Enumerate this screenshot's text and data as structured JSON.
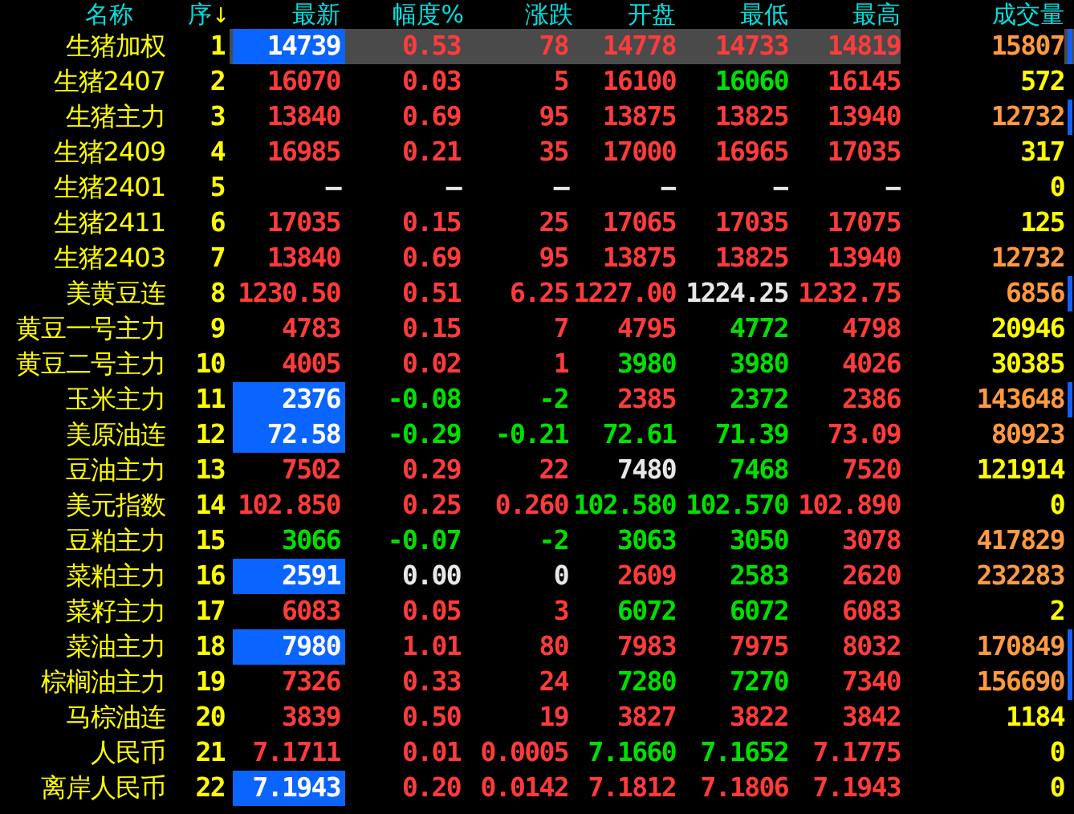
{
  "columns": [
    {
      "label": "名称"
    },
    {
      "label": "序",
      "sort_arrow": "↓"
    },
    {
      "label": "最新"
    },
    {
      "label": "幅度%"
    },
    {
      "label": "涨跌"
    },
    {
      "label": "开盘"
    },
    {
      "label": "最低"
    },
    {
      "label": "最高"
    },
    {
      "label": "成交量"
    }
  ],
  "rows": [
    {
      "name": "生猪加权",
      "seq": "1",
      "selected": true,
      "marker": true,
      "last": {
        "text": "14739",
        "flash": true
      },
      "pct": {
        "text": "0.53",
        "up": true,
        "down": false
      },
      "chg": {
        "text": "78",
        "up": true,
        "down": false
      },
      "open": {
        "text": "14778",
        "up": true,
        "down": false
      },
      "low": {
        "text": "14733",
        "up": true,
        "down": false
      },
      "high": {
        "text": "14819",
        "up": true,
        "down": false
      },
      "volume": {
        "text": "15807",
        "large": true
      }
    },
    {
      "name": "生猪2407",
      "seq": "2",
      "selected": false,
      "marker": false,
      "last": {
        "text": "16070",
        "up": true,
        "down": false,
        "flash": false
      },
      "pct": {
        "text": "0.03",
        "up": true,
        "down": false
      },
      "chg": {
        "text": "5",
        "up": true,
        "down": false
      },
      "open": {
        "text": "16100",
        "up": true,
        "down": false
      },
      "low": {
        "text": "16060",
        "up": false,
        "down": true
      },
      "high": {
        "text": "16145",
        "up": true,
        "down": false
      },
      "volume": {
        "text": "572",
        "large": false
      }
    },
    {
      "name": "生猪主力",
      "seq": "3",
      "selected": false,
      "marker": true,
      "last": {
        "text": "13840",
        "up": true,
        "down": false,
        "flash": false
      },
      "pct": {
        "text": "0.69",
        "up": true,
        "down": false
      },
      "chg": {
        "text": "95",
        "up": true,
        "down": false
      },
      "open": {
        "text": "13875",
        "up": true,
        "down": false
      },
      "low": {
        "text": "13825",
        "up": true,
        "down": false
      },
      "high": {
        "text": "13940",
        "up": true,
        "down": false
      },
      "volume": {
        "text": "12732",
        "large": true
      }
    },
    {
      "name": "生猪2409",
      "seq": "4",
      "selected": false,
      "marker": false,
      "last": {
        "text": "16985",
        "up": true,
        "down": false,
        "flash": false
      },
      "pct": {
        "text": "0.21",
        "up": true,
        "down": false
      },
      "chg": {
        "text": "35",
        "up": true,
        "down": false
      },
      "open": {
        "text": "17000",
        "up": true,
        "down": false
      },
      "low": {
        "text": "16965",
        "up": true,
        "down": false
      },
      "high": {
        "text": "17035",
        "up": true,
        "down": false
      },
      "volume": {
        "text": "317",
        "large": false
      }
    },
    {
      "name": "生猪2401",
      "seq": "5",
      "selected": false,
      "marker": false,
      "last": {
        "text": "—",
        "up": false,
        "down": false,
        "flash": false
      },
      "pct": {
        "text": "—",
        "up": false,
        "down": false
      },
      "chg": {
        "text": "—",
        "up": false,
        "down": false
      },
      "open": {
        "text": "—",
        "up": false,
        "down": false
      },
      "low": {
        "text": "—",
        "up": false,
        "down": false
      },
      "high": {
        "text": "—",
        "up": false,
        "down": false
      },
      "volume": {
        "text": "0",
        "large": false
      }
    },
    {
      "name": "生猪2411",
      "seq": "6",
      "selected": false,
      "marker": false,
      "last": {
        "text": "17035",
        "up": true,
        "down": false,
        "flash": false
      },
      "pct": {
        "text": "0.15",
        "up": true,
        "down": false
      },
      "chg": {
        "text": "25",
        "up": true,
        "down": false
      },
      "open": {
        "text": "17065",
        "up": true,
        "down": false
      },
      "low": {
        "text": "17035",
        "up": true,
        "down": false
      },
      "high": {
        "text": "17075",
        "up": true,
        "down": false
      },
      "volume": {
        "text": "125",
        "large": false
      }
    },
    {
      "name": "生猪2403",
      "seq": "7",
      "selected": false,
      "marker": false,
      "last": {
        "text": "13840",
        "up": true,
        "down": false,
        "flash": false
      },
      "pct": {
        "text": "0.69",
        "up": true,
        "down": false
      },
      "chg": {
        "text": "95",
        "up": true,
        "down": false
      },
      "open": {
        "text": "13875",
        "up": true,
        "down": false
      },
      "low": {
        "text": "13825",
        "up": true,
        "down": false
      },
      "high": {
        "text": "13940",
        "up": true,
        "down": false
      },
      "volume": {
        "text": "12732",
        "large": true
      }
    },
    {
      "name": "美黄豆连",
      "seq": "8",
      "selected": false,
      "marker": true,
      "last": {
        "text": "1230.50",
        "up": true,
        "down": false,
        "flash": false
      },
      "pct": {
        "text": "0.51",
        "up": true,
        "down": false
      },
      "chg": {
        "text": "6.25",
        "up": true,
        "down": false
      },
      "open": {
        "text": "1227.00",
        "up": true,
        "down": false
      },
      "low": {
        "text": "1224.25",
        "up": false,
        "down": false
      },
      "high": {
        "text": "1232.75",
        "up": true,
        "down": false
      },
      "volume": {
        "text": "6856",
        "large": true
      }
    },
    {
      "name": "黄豆一号主力",
      "seq": "9",
      "selected": false,
      "marker": false,
      "last": {
        "text": "4783",
        "up": true,
        "down": false,
        "flash": false
      },
      "pct": {
        "text": "0.15",
        "up": true,
        "down": false
      },
      "chg": {
        "text": "7",
        "up": true,
        "down": false
      },
      "open": {
        "text": "4795",
        "up": true,
        "down": false
      },
      "low": {
        "text": "4772",
        "up": false,
        "down": true
      },
      "high": {
        "text": "4798",
        "up": true,
        "down": false
      },
      "volume": {
        "text": "20946",
        "large": false
      }
    },
    {
      "name": "黄豆二号主力",
      "seq": "10",
      "selected": false,
      "marker": false,
      "last": {
        "text": "4005",
        "up": true,
        "down": false,
        "flash": false
      },
      "pct": {
        "text": "0.02",
        "up": true,
        "down": false
      },
      "chg": {
        "text": "1",
        "up": true,
        "down": false
      },
      "open": {
        "text": "3980",
        "up": false,
        "down": true
      },
      "low": {
        "text": "3980",
        "up": false,
        "down": true
      },
      "high": {
        "text": "4026",
        "up": true,
        "down": false
      },
      "volume": {
        "text": "30385",
        "large": false
      }
    },
    {
      "name": "玉米主力",
      "seq": "11",
      "selected": false,
      "marker": true,
      "last": {
        "text": "2376",
        "flash": true
      },
      "pct": {
        "text": "-0.08",
        "up": false,
        "down": true
      },
      "chg": {
        "text": "-2",
        "up": false,
        "down": true
      },
      "open": {
        "text": "2385",
        "up": true,
        "down": false
      },
      "low": {
        "text": "2372",
        "up": false,
        "down": true
      },
      "high": {
        "text": "2386",
        "up": true,
        "down": false
      },
      "volume": {
        "text": "143648",
        "large": true
      }
    },
    {
      "name": "美原油连",
      "seq": "12",
      "selected": false,
      "marker": false,
      "last": {
        "text": "72.58",
        "flash": true
      },
      "pct": {
        "text": "-0.29",
        "up": false,
        "down": true
      },
      "chg": {
        "text": "-0.21",
        "up": false,
        "down": true
      },
      "open": {
        "text": "72.61",
        "up": false,
        "down": true
      },
      "low": {
        "text": "71.39",
        "up": false,
        "down": true
      },
      "high": {
        "text": "73.09",
        "up": true,
        "down": false
      },
      "volume": {
        "text": "80923",
        "large": true
      }
    },
    {
      "name": "豆油主力",
      "seq": "13",
      "selected": false,
      "marker": false,
      "last": {
        "text": "7502",
        "up": true,
        "down": false,
        "flash": false
      },
      "pct": {
        "text": "0.29",
        "up": true,
        "down": false
      },
      "chg": {
        "text": "22",
        "up": true,
        "down": false
      },
      "open": {
        "text": "7480",
        "up": false,
        "down": false
      },
      "low": {
        "text": "7468",
        "up": false,
        "down": true
      },
      "high": {
        "text": "7520",
        "up": true,
        "down": false
      },
      "volume": {
        "text": "121914",
        "large": false
      }
    },
    {
      "name": "美元指数",
      "seq": "14",
      "selected": false,
      "marker": false,
      "last": {
        "text": "102.850",
        "up": true,
        "down": false,
        "flash": false
      },
      "pct": {
        "text": "0.25",
        "up": true,
        "down": false
      },
      "chg": {
        "text": "0.260",
        "up": true,
        "down": false
      },
      "open": {
        "text": "102.580",
        "up": false,
        "down": true
      },
      "low": {
        "text": "102.570",
        "up": false,
        "down": true
      },
      "high": {
        "text": "102.890",
        "up": true,
        "down": false
      },
      "volume": {
        "text": "0",
        "large": false
      }
    },
    {
      "name": "豆粕主力",
      "seq": "15",
      "selected": false,
      "marker": false,
      "last": {
        "text": "3066",
        "up": false,
        "down": true,
        "flash": false
      },
      "pct": {
        "text": "-0.07",
        "up": false,
        "down": true
      },
      "chg": {
        "text": "-2",
        "up": false,
        "down": true
      },
      "open": {
        "text": "3063",
        "up": false,
        "down": true
      },
      "low": {
        "text": "3050",
        "up": false,
        "down": true
      },
      "high": {
        "text": "3078",
        "up": true,
        "down": false
      },
      "volume": {
        "text": "417829",
        "large": true
      }
    },
    {
      "name": "菜粕主力",
      "seq": "16",
      "selected": false,
      "marker": false,
      "last": {
        "text": "2591",
        "flash": true
      },
      "pct": {
        "text": "0.00",
        "up": false,
        "down": false
      },
      "chg": {
        "text": "0",
        "up": false,
        "down": false
      },
      "open": {
        "text": "2609",
        "up": true,
        "down": false
      },
      "low": {
        "text": "2583",
        "up": false,
        "down": true
      },
      "high": {
        "text": "2620",
        "up": true,
        "down": false
      },
      "volume": {
        "text": "232283",
        "large": true
      }
    },
    {
      "name": "菜籽主力",
      "seq": "17",
      "selected": false,
      "marker": false,
      "last": {
        "text": "6083",
        "up": true,
        "down": false,
        "flash": false
      },
      "pct": {
        "text": "0.05",
        "up": true,
        "down": false
      },
      "chg": {
        "text": "3",
        "up": true,
        "down": false
      },
      "open": {
        "text": "6072",
        "up": false,
        "down": true
      },
      "low": {
        "text": "6072",
        "up": false,
        "down": true
      },
      "high": {
        "text": "6083",
        "up": true,
        "down": false
      },
      "volume": {
        "text": "2",
        "large": false
      }
    },
    {
      "name": "菜油主力",
      "seq": "18",
      "selected": false,
      "marker": true,
      "last": {
        "text": "7980",
        "flash": true
      },
      "pct": {
        "text": "1.01",
        "up": true,
        "down": false
      },
      "chg": {
        "text": "80",
        "up": true,
        "down": false
      },
      "open": {
        "text": "7983",
        "up": true,
        "down": false
      },
      "low": {
        "text": "7975",
        "up": true,
        "down": false
      },
      "high": {
        "text": "8032",
        "up": true,
        "down": false
      },
      "volume": {
        "text": "170849",
        "large": true
      }
    },
    {
      "name": "棕榈油主力",
      "seq": "19",
      "selected": false,
      "marker": true,
      "last": {
        "text": "7326",
        "up": true,
        "down": false,
        "flash": false
      },
      "pct": {
        "text": "0.33",
        "up": true,
        "down": false
      },
      "chg": {
        "text": "24",
        "up": true,
        "down": false
      },
      "open": {
        "text": "7280",
        "up": false,
        "down": true
      },
      "low": {
        "text": "7270",
        "up": false,
        "down": true
      },
      "high": {
        "text": "7340",
        "up": true,
        "down": false
      },
      "volume": {
        "text": "156690",
        "large": true
      }
    },
    {
      "name": "马棕油连",
      "seq": "20",
      "selected": false,
      "marker": false,
      "last": {
        "text": "3839",
        "up": true,
        "down": false,
        "flash": false
      },
      "pct": {
        "text": "0.50",
        "up": true,
        "down": false
      },
      "chg": {
        "text": "19",
        "up": true,
        "down": false
      },
      "open": {
        "text": "3827",
        "up": true,
        "down": false
      },
      "low": {
        "text": "3822",
        "up": true,
        "down": false
      },
      "high": {
        "text": "3842",
        "up": true,
        "down": false
      },
      "volume": {
        "text": "1184",
        "large": false
      }
    },
    {
      "name": "人民币",
      "seq": "21",
      "selected": false,
      "marker": false,
      "last": {
        "text": "7.1711",
        "up": true,
        "down": false,
        "flash": false
      },
      "pct": {
        "text": "0.01",
        "up": true,
        "down": false
      },
      "chg": {
        "text": "0.0005",
        "up": true,
        "down": false
      },
      "open": {
        "text": "7.1660",
        "up": false,
        "down": true
      },
      "low": {
        "text": "7.1652",
        "up": false,
        "down": true
      },
      "high": {
        "text": "7.1775",
        "up": true,
        "down": false
      },
      "volume": {
        "text": "0",
        "large": false
      }
    },
    {
      "name": "离岸人民币",
      "seq": "22",
      "selected": false,
      "marker": false,
      "last": {
        "text": "7.1943",
        "flash": true
      },
      "pct": {
        "text": "0.20",
        "up": true,
        "down": false
      },
      "chg": {
        "text": "0.0142",
        "up": true,
        "down": false
      },
      "open": {
        "text": "7.1812",
        "up": true,
        "down": false
      },
      "low": {
        "text": "7.1806",
        "up": true,
        "down": false
      },
      "high": {
        "text": "7.1943",
        "up": true,
        "down": false
      },
      "volume": {
        "text": "0",
        "large": false
      }
    }
  ]
}
